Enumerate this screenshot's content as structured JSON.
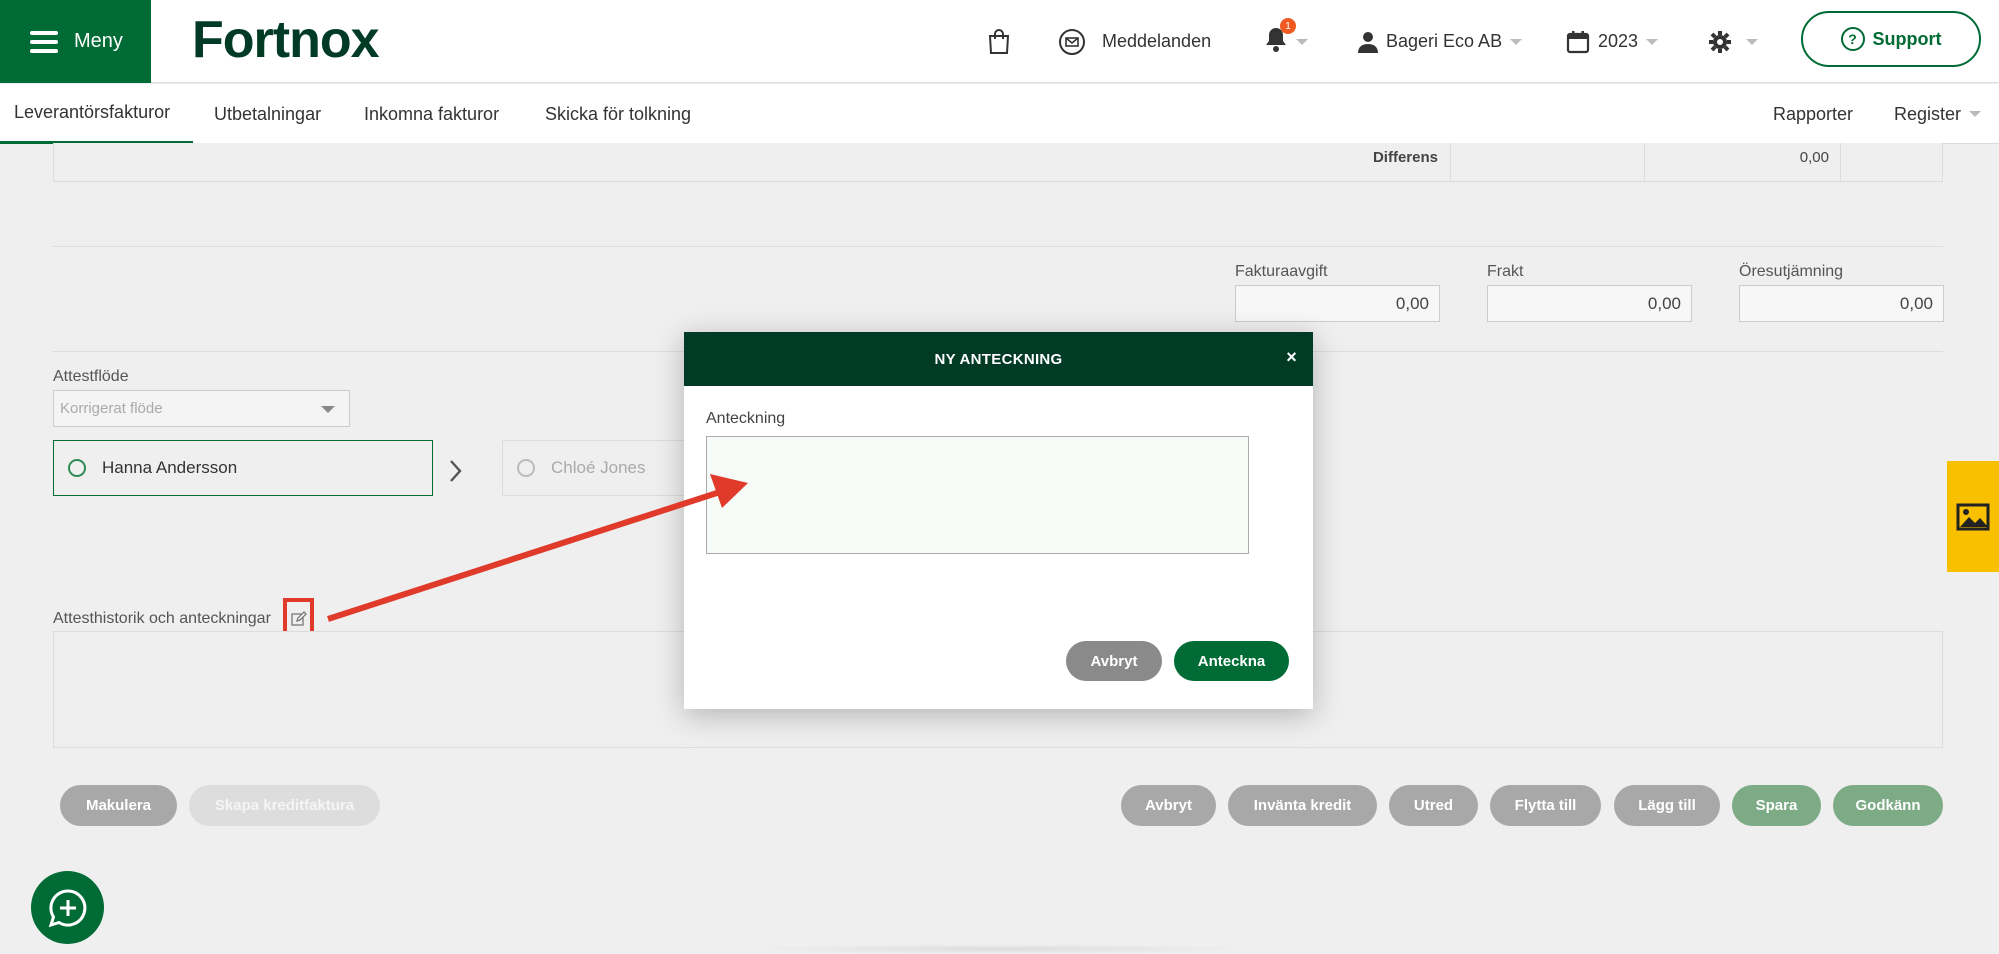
{
  "header": {
    "menu_label": "Meny",
    "logo": "Fortnox",
    "messages_label": "Meddelanden",
    "notification_count": "1",
    "company": "Bageri Eco AB",
    "year": "2023",
    "support_label": "Support",
    "brand_color": "#006b34",
    "dark_green": "#013b26"
  },
  "subnav": {
    "tabs": [
      {
        "label": "Leverantörsfakturor",
        "active": true
      },
      {
        "label": "Utbetalningar"
      },
      {
        "label": "Inkomna fakturor"
      },
      {
        "label": "Skicka för tolkning"
      }
    ],
    "right": [
      {
        "label": "Rapporter"
      },
      {
        "label": "Register"
      }
    ]
  },
  "summary": {
    "label": "Differens",
    "value": "0,00"
  },
  "fees": {
    "invoice_fee": {
      "label": "Fakturaavgift",
      "value": "0,00"
    },
    "freight": {
      "label": "Frakt",
      "value": "0,00"
    },
    "rounding": {
      "label": "Öresutjämning",
      "value": "0,00"
    }
  },
  "attest": {
    "label": "Attestflöde",
    "flow_placeholder": "Korrigerat flöde",
    "persons": [
      "Hanna Andersson",
      "Chloé Jones"
    ]
  },
  "history": {
    "label": "Attesthistorik och anteckningar"
  },
  "actions": {
    "left": [
      "Makulera",
      "Skapa kreditfaktura"
    ],
    "right": [
      "Avbryt",
      "Inväntа kredit",
      "Utred",
      "Flytta till",
      "Lägg till",
      "Spara",
      "Godkänn"
    ]
  },
  "modal": {
    "title": "NY ANTECKNING",
    "close": "×",
    "field_label": "Anteckning",
    "field_value": "",
    "cancel_label": "Avbryt",
    "submit_label": "Anteckna"
  },
  "annotation_color": "#e03a2a"
}
